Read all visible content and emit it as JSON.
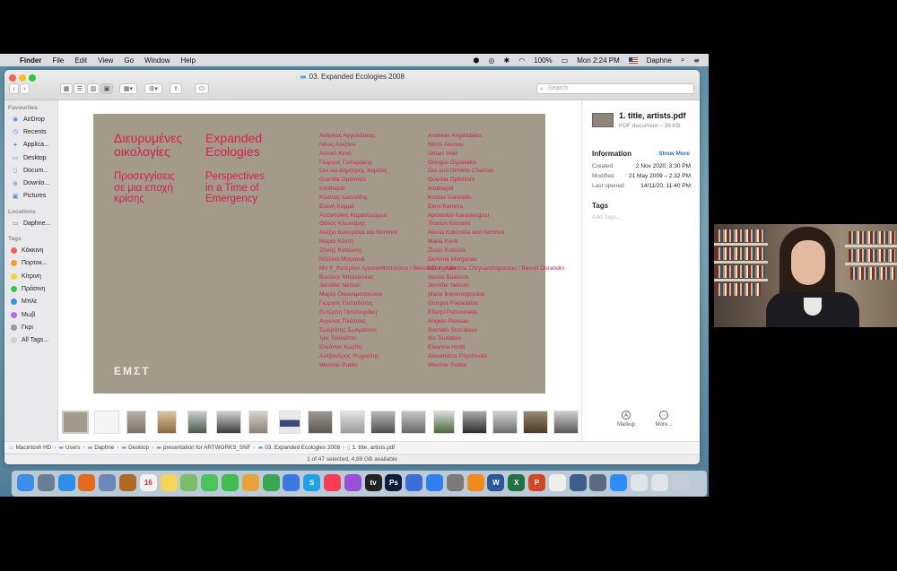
{
  "menubar": {
    "apple_glyph": "",
    "app": "Finder",
    "items": [
      "File",
      "Edit",
      "View",
      "Go",
      "Window",
      "Help"
    ],
    "battery": "100%",
    "clock": "Mon 2:24 PM",
    "user": "Daphne"
  },
  "window": {
    "title": "03. Expanded Ecologies 2008",
    "search_placeholder": "Search"
  },
  "sidebar": {
    "favourites_label": "Favourites",
    "favourites": [
      {
        "label": "AirDrop",
        "icon": "airdrop-icon"
      },
      {
        "label": "Recents",
        "icon": "clock-icon"
      },
      {
        "label": "Applica...",
        "icon": "apps-icon"
      },
      {
        "label": "Desktop",
        "icon": "desktop-icon"
      },
      {
        "label": "Docum...",
        "icon": "document-icon"
      },
      {
        "label": "Downlo...",
        "icon": "download-icon"
      },
      {
        "label": "Pictures",
        "icon": "pictures-icon"
      }
    ],
    "locations_label": "Locations",
    "locations": [
      {
        "label": "Daphne...",
        "icon": "laptop-icon"
      }
    ],
    "tags_label": "Tags",
    "tags": [
      {
        "label": "Κόκκινη",
        "color": "#fc5f57"
      },
      {
        "label": "Πορτοκ...",
        "color": "#fd9a2f"
      },
      {
        "label": "Κίτρινη",
        "color": "#fdd12e"
      },
      {
        "label": "Πράσινη",
        "color": "#36c84a"
      },
      {
        "label": "Μπλε",
        "color": "#3a8ef0"
      },
      {
        "label": "Μωβ",
        "color": "#b46fd8"
      },
      {
        "label": "Γκρι",
        "color": "#9a9a9a"
      },
      {
        "label": "All Tags...",
        "color": "#d0d0d0"
      }
    ]
  },
  "document": {
    "title_gr": [
      "Διευρυμένες",
      "οικολογίες"
    ],
    "subtitle_gr": [
      "Προσεγγίσεις",
      "σε μια εποχή",
      "κρίσης"
    ],
    "title_en": [
      "Expanded",
      "Ecologies"
    ],
    "subtitle_en": [
      "Perspectives",
      "in a Time of",
      "Emergency"
    ],
    "artists_gr": [
      "Ανδρέας Αγγελιδάκης",
      "Νίκος Αλεξίου",
      "Αστικό Κενό",
      "Γιώργος Γυπαράκης",
      "Ooi και Δημήτρης Χαρίτος",
      "Guerilla Optimists",
      "Intothepill",
      "Κώστας Ιωαννίδης",
      "Ελένη Καμμά",
      "Απόστολος Καρασταύρου",
      "Θάνος Κλωνάρης",
      "Αλέξια Κοκορέλια και Norrmnt",
      "Μαρία Κόντη",
      "Ζήσης Κοτιώνης",
      "Ντέλινα Μογκανά",
      "Mo Y_Κατερίνα Χρυσανθοπούλου / Benoît Durandin",
      "Βασίλης Μπαλάσκας",
      "Jennifer Nelson",
      "Μαρία Οικονομοπούλου",
      "Γιώργος Παπαδάτος",
      "Ευτέρπη Πατσουράκη",
      "Αγγελος Πλέσσας",
      "Σωκράτης Σωκράτους",
      "Ίρις Τουλιάτου",
      "Ελεάννα Χωρίτη",
      "Αλέξανδρος Ψυχούλης",
      "Wermer Public"
    ],
    "artists_en": [
      "Andreas Angelidakis",
      "Nikos Alexiou",
      "Urban Void",
      "Giorgos Gyparakis",
      "Ooi and Dimitris Charitos",
      "Guerilla Optimists",
      "Intothepill",
      "Kostas Ioannidis",
      "Eleni Kamma",
      "Apostolos Karastergiou",
      "Thanos Klonaris",
      "Alexia Kokorelia and Norrmnt",
      "Maria Konti",
      "Zissis Kotionis",
      "DeAnna Morganas",
      "Mo Y_Katerina Chrysanthopoulou / Benoît Durandin",
      "Vassili Balatsos",
      "Jennifer Nelson",
      "Maria Ikonomopoulou",
      "Giorgos Papadatos",
      "Efterpi Patsourakis",
      "Angelo Plessas",
      "Socratis Socratous",
      "Iris Touliatou",
      "Eleanna Horiti",
      "Alexandros Psychoulis",
      "Wermer Public"
    ],
    "logo": "ΕΜΣΤ"
  },
  "pathbar": [
    "Macintosh HD",
    "Users",
    "Daphne",
    "Desktop",
    "presentation for ARTWORKS_SNF",
    "03. Expanded Ecologies 2008",
    "1. title, artists.pdf"
  ],
  "status": "1 of 47 selected, 4,89 GB available",
  "inspector": {
    "file_name": "1. title, artists.pdf",
    "file_kind": "PDF document – 36 KB",
    "info_label": "Information",
    "show_more": "Show More",
    "rows": [
      {
        "label": "Created",
        "value": "2 Nov 2020, 3:30 PM"
      },
      {
        "label": "Modified",
        "value": "21 May 2009 – 2:32 PM"
      },
      {
        "label": "Last opened",
        "value": "14/11/20, 11:40 PM"
      }
    ],
    "tags_label": "Tags",
    "add_tags": "Add Tags...",
    "markup_label": "Markup",
    "more_label": "More..."
  },
  "dock": {
    "apps": [
      {
        "name": "finder-icon",
        "color": "#3b8fe8",
        "label": ""
      },
      {
        "name": "launchpad-icon",
        "color": "#6a7d96",
        "label": ""
      },
      {
        "name": "safari-icon",
        "color": "#2f8ee8",
        "label": ""
      },
      {
        "name": "firefox-icon",
        "color": "#e66a1e",
        "label": ""
      },
      {
        "name": "preview-icon",
        "color": "#6a88b8",
        "label": ""
      },
      {
        "name": "books-icon",
        "color": "#b06a28",
        "label": ""
      },
      {
        "name": "calendar-icon",
        "color": "#f2f2f2",
        "label": "16"
      },
      {
        "name": "notes-icon",
        "color": "#f5d45a",
        "label": ""
      },
      {
        "name": "maps-icon",
        "color": "#7bbd6a",
        "label": ""
      },
      {
        "name": "messages-icon",
        "color": "#4bc45e",
        "label": ""
      },
      {
        "name": "facetime-icon",
        "color": "#3cbf4e",
        "label": ""
      },
      {
        "name": "photos-icon",
        "color": "#e9a23b",
        "label": ""
      },
      {
        "name": "numbers-icon",
        "color": "#38a852",
        "label": ""
      },
      {
        "name": "keynote-icon",
        "color": "#3a7ae0",
        "label": ""
      },
      {
        "name": "skype-icon",
        "color": "#1ea1e8",
        "label": "S"
      },
      {
        "name": "music-icon",
        "color": "#fa3d55",
        "label": ""
      },
      {
        "name": "podcasts-icon",
        "color": "#9b4fd8",
        "label": ""
      },
      {
        "name": "apple-tv-icon",
        "color": "#222222",
        "label": "tv"
      },
      {
        "name": "photoshop-icon",
        "color": "#0d1c3d",
        "label": "Ps"
      },
      {
        "name": "tools-icon",
        "color": "#3c6ed6",
        "label": ""
      },
      {
        "name": "app-store-icon",
        "color": "#2f7ff0",
        "label": ""
      },
      {
        "name": "settings-icon",
        "color": "#7a7a7a",
        "label": ""
      },
      {
        "name": "vlc-icon",
        "color": "#f08a1c",
        "label": ""
      },
      {
        "name": "word-icon",
        "color": "#2b579a",
        "label": "W"
      },
      {
        "name": "excel-icon",
        "color": "#217346",
        "label": "X"
      },
      {
        "name": "powerpoint-icon",
        "color": "#d24726",
        "label": "P"
      },
      {
        "name": "textedit-icon",
        "color": "#eeeeee",
        "label": ""
      },
      {
        "name": "quicktime-icon",
        "color": "#3d5d8a",
        "label": ""
      },
      {
        "name": "screenshot-icon",
        "color": "#5a6a80",
        "label": ""
      },
      {
        "name": "zoom-icon",
        "color": "#2d8cff",
        "label": ""
      },
      {
        "name": "document-stack-icon",
        "color": "#dfe4ea",
        "label": ""
      },
      {
        "name": "downloads-stack-icon",
        "color": "#dfe4ea",
        "label": ""
      },
      {
        "name": "trash-icon",
        "color": "#c4ccd6",
        "label": ""
      }
    ]
  }
}
